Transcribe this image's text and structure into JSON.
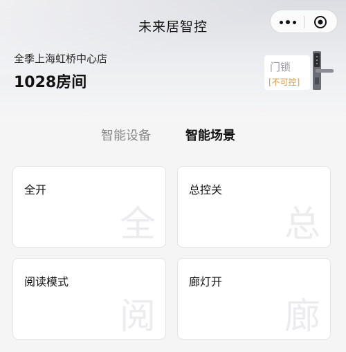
{
  "header": {
    "title": "未来居智控",
    "hotel_name": "全季上海虹桥中心店",
    "room_number": "1028房间"
  },
  "lock": {
    "label": "门锁",
    "status": "[不可控]",
    "status_color": "#e39a3a",
    "icon": "door-lock-icon"
  },
  "tabs": [
    {
      "label": "智能设备",
      "active": false
    },
    {
      "label": "智能场景",
      "active": true
    }
  ],
  "scenes": [
    {
      "label": "全开",
      "watermark": "全"
    },
    {
      "label": "总控关",
      "watermark": "总"
    },
    {
      "label": "阅读模式",
      "watermark": "阅"
    },
    {
      "label": "廊灯开",
      "watermark": "廊"
    }
  ],
  "capsule": {
    "more_icon": "more-icon",
    "close_icon": "close-icon"
  }
}
